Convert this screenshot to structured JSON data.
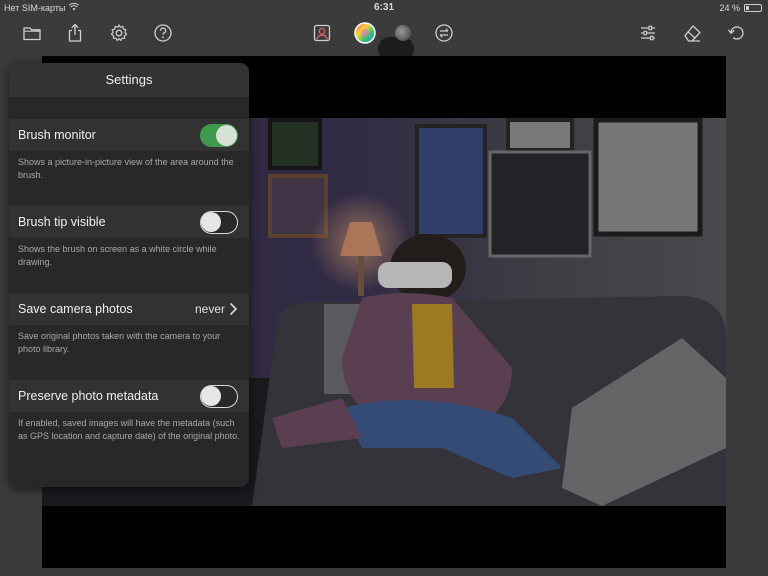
{
  "status_bar": {
    "carrier": "Нет SIM-карты",
    "time": "6:31",
    "battery_text": "24 %",
    "battery_level": 0.24
  },
  "toolbar": {
    "left_icons": [
      "folder-icon",
      "share-icon",
      "gear-icon",
      "help-icon"
    ],
    "center_icons": [
      "portrait-mask-icon",
      "color-wheel-icon",
      "brush-opacity-icon",
      "swap-icon"
    ],
    "right_icons": [
      "sliders-icon",
      "eraser-icon",
      "undo-icon"
    ]
  },
  "settings": {
    "title": "Settings",
    "brush_monitor": {
      "label": "Brush monitor",
      "enabled": true,
      "description": "Shows a picture-in-picture view of the area around the brush."
    },
    "brush_tip": {
      "label": "Brush tip visible",
      "enabled": false,
      "description": "Shows the brush on screen as a white circle while drawing."
    },
    "save_camera": {
      "label": "Save camera photos",
      "value": "never",
      "description": "Save original photos taken with the camera to your photo library."
    },
    "preserve_metadata": {
      "label": "Preserve photo metadata",
      "enabled": false,
      "description": "If enabled, saved images will have the metadata (such as GPS location and capture date) of the original photo."
    }
  },
  "colors": {
    "toggle_on": "#3f9a4e",
    "popover_bg": "#303031",
    "canvas_bg": "#000000"
  }
}
